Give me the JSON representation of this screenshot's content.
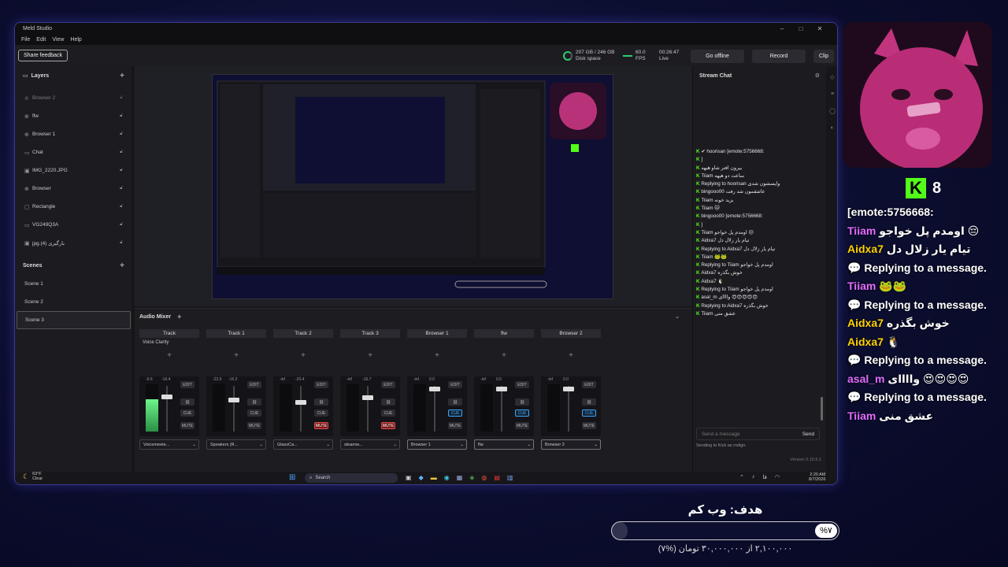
{
  "window": {
    "title": "Meld Studio",
    "menu": [
      "File",
      "Edit",
      "View",
      "Help"
    ],
    "controls": [
      "–",
      "□",
      "✕"
    ]
  },
  "toolbar": {
    "share_feedback": "Share feedback",
    "disk_value": "207 GB / 246 GB",
    "disk_label": "Disk space",
    "fps_value": "60.0",
    "fps_label": "FPS",
    "live_time": "00:26:47",
    "live_label": "Live",
    "go_offline": "Go offline",
    "record": "Record",
    "clip": "Clip"
  },
  "layers": {
    "title": "Layers",
    "items": [
      {
        "name": "Browser 2",
        "icon": "globe-icon",
        "dim": true
      },
      {
        "name": "flw",
        "icon": "globe-icon"
      },
      {
        "name": "Browser 1",
        "icon": "globe-icon"
      },
      {
        "name": "Chat",
        "icon": "chat-icon"
      },
      {
        "name": "IMG_2220.JPG",
        "icon": "image-icon"
      },
      {
        "name": "Browser",
        "icon": "globe-icon"
      },
      {
        "name": "Rectangle",
        "icon": "rectangle-icon"
      },
      {
        "name": "VG249Q3A",
        "icon": "monitor-icon"
      },
      {
        "name": "jpg.(4) بارگیری",
        "icon": "image-icon"
      }
    ]
  },
  "scenes": {
    "title": "Scenes",
    "items": [
      "Scene 1",
      "Scene 2",
      "Scene 3"
    ],
    "active": "Scene 3"
  },
  "mixer": {
    "title": "Audio Mixer",
    "tracks": [
      {
        "name": "Track",
        "fx": "Voice Clarity",
        "db1": "-0.6",
        "db2": "-16.4",
        "device": "Voicemeete...",
        "level": 0.75,
        "fader": 0.78,
        "cue": false,
        "mute": false
      },
      {
        "name": "Track 1",
        "fx": "",
        "db1": "-22.9",
        "db2": "-16.2",
        "device": "Speakers (R...",
        "level": 0,
        "fader": 0.72,
        "cue": false,
        "mute": false
      },
      {
        "name": "Track 2",
        "fx": "",
        "db1": "-inf",
        "db2": "-20.4",
        "device": "GlassCa...",
        "level": 0,
        "fader": 0.66,
        "cue": false,
        "mute": true
      },
      {
        "name": "Track 3",
        "fx": "",
        "db1": "-inf",
        "db2": "-16.7",
        "device": "steamw...",
        "level": 0,
        "fader": 0.76,
        "cue": false,
        "mute": true
      },
      {
        "name": "Browser 1",
        "fx": "",
        "db1": "-inf",
        "db2": "0.0",
        "device": "Browser 1",
        "level": 0,
        "fader": 0.98,
        "cue": true,
        "mute": false
      },
      {
        "name": "flw",
        "fx": "",
        "db1": "-inf",
        "db2": "0.0",
        "device": "flw",
        "level": 0,
        "fader": 0.98,
        "cue": true,
        "mute": false
      },
      {
        "name": "Browser 2",
        "fx": "",
        "db1": "-inf",
        "db2": "0.0",
        "device": "Browser 2",
        "level": 0,
        "fader": 0.98,
        "cue": true,
        "mute": false
      }
    ],
    "edit_label": "EDIT",
    "cue_label": "CUE",
    "mute_label": "MUTE"
  },
  "chat": {
    "title": "Stream Chat",
    "input_placeholder": "Send a message",
    "send": "Send",
    "sending_to": "Sending to Kick as rrelign.",
    "version": "Version 0.10.5.1",
    "messages": [
      "✔ hoorisan [emote:5756668:",
      "]",
      "بیرون افتر شاو هیهه",
      "Tiiam ساعت دو هیهه",
      "Replying to hoorisan وایسشون شدی",
      "bingooo00 عاشقمون شد رفت",
      "Tiiam بزید خونه",
      "Tiiam 🐱",
      "bingooo00 [emote:5756668:",
      "]",
      "Tiiam اومدم پل خواجو 😔",
      "Aidxa7 تیام یار زلال دل",
      "Replying to Aidxa7 تیام یار زلال دل",
      "Tiiam 🐸🐸",
      "Replying to Tiiam اومدم پل خواجو",
      "Aidxa7 خوش بگذره",
      "Aidxa7 🐧",
      "Replying to Tiiam اومدم پل خواجو",
      "asal_m واااای 😍😍😍😍😍",
      "Replying to Aidxa7 خوش بگذره",
      "Tiiam عشق منی"
    ]
  },
  "taskbar": {
    "weather_temp": "63°F",
    "weather_desc": "Clear",
    "search": "Search",
    "time": "2:20 AM",
    "date": "8/7/2026",
    "lang": "فا"
  },
  "overlay": {
    "kick_count": "8",
    "chat": [
      {
        "user": "",
        "text": "[emote:5756668:"
      },
      {
        "user": "Tiiam",
        "text": "اومدم پل خواجو 😔"
      },
      {
        "user": "Aidxa7",
        "text": "تیام یار زلال دل"
      },
      {
        "user": "",
        "text": "Replying to a message."
      },
      {
        "user": "Tiiam",
        "text": "🐸🐸"
      },
      {
        "user": "",
        "text": "Replying to a message."
      },
      {
        "user": "Aidxa7",
        "text": "خوش بگذره"
      },
      {
        "user": "Aidxa7",
        "text": "🐧"
      },
      {
        "user": "",
        "text": "Replying to a message."
      },
      {
        "user": "asal_m",
        "text": "واااای 😍😍😍😍"
      },
      {
        "user": "",
        "text": "Replying to a message."
      },
      {
        "user": "Tiiam",
        "text": "عشق منی"
      }
    ],
    "goal_title": "هدف: وب کم",
    "goal_percent": "%۷",
    "goal_value": 0.07,
    "goal_sub": "۲,۱۰۰,۰۰۰ از ۳۰,۰۰۰,۰۰۰ تومان (%۷)"
  },
  "colors": {
    "kick_green": "#53fc18",
    "accent_pink": "#ff6cc8",
    "window_border": "#3a3a8a"
  }
}
